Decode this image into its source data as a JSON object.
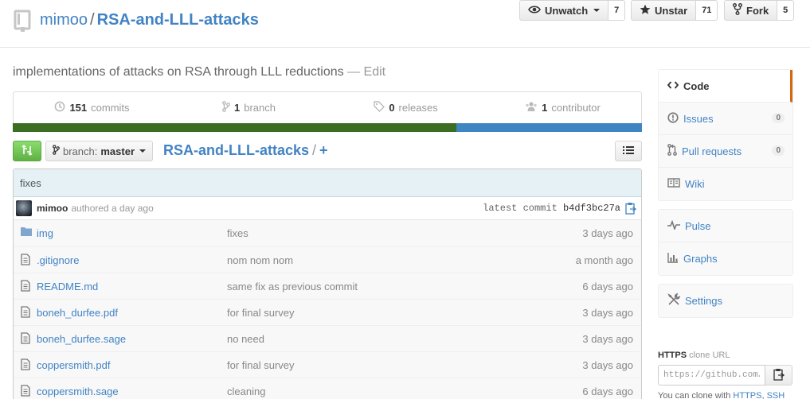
{
  "header": {
    "owner": "mimoo",
    "separator": "/",
    "repo_name": "RSA-and-LLL-attacks",
    "actions": [
      {
        "label": "Unwatch",
        "count": "7"
      },
      {
        "label": "Unstar",
        "count": "71"
      },
      {
        "label": "Fork",
        "count": "5"
      }
    ]
  },
  "description": {
    "text": "implementations of attacks on RSA through LLL reductions",
    "edit_sep": " — ",
    "edit_label": "Edit"
  },
  "summary": {
    "commits": {
      "count": "151",
      "label": "commits"
    },
    "branches": {
      "count": "1",
      "label": "branch"
    },
    "releases": {
      "count": "0",
      "label": "releases"
    },
    "contributors": {
      "count": "1",
      "label": "contributor"
    }
  },
  "language_bar": {
    "colors": [
      "#3b6e22",
      "#3e85c2"
    ],
    "fractions": [
      0.705,
      0.295
    ]
  },
  "file_nav": {
    "branch_label": "branch:",
    "branch_value": "master",
    "breadcrumb_root": "RSA-and-LLL-attacks",
    "breadcrumb_sep": "/",
    "breadcrumb_plus": "+"
  },
  "latest_commit": {
    "message": "fixes",
    "author": "mimoo",
    "ago": "authored a day ago",
    "latest_label": "latest commit",
    "sha": "b4df3bc27a"
  },
  "files": [
    {
      "icon": "folder-icon",
      "name": "img",
      "message": "fixes",
      "age": "3 days ago"
    },
    {
      "icon": "file-icon",
      "name": ".gitignore",
      "message": "nom nom nom",
      "age": "a month ago"
    },
    {
      "icon": "file-icon",
      "name": "README.md",
      "message": "same fix as previous commit",
      "age": "6 days ago"
    },
    {
      "icon": "file-icon",
      "name": "boneh_durfee.pdf",
      "message": "for final survey",
      "age": "3 days ago"
    },
    {
      "icon": "file-icon",
      "name": "boneh_durfee.sage",
      "message": "no need",
      "age": "3 days ago"
    },
    {
      "icon": "file-icon",
      "name": "coppersmith.pdf",
      "message": "for final survey",
      "age": "3 days ago"
    },
    {
      "icon": "file-icon",
      "name": "coppersmith.sage",
      "message": "cleaning",
      "age": "6 days ago"
    }
  ],
  "sidebar": {
    "items": [
      {
        "label": "Code",
        "icon": "code-icon",
        "selected": true
      },
      {
        "label": "Issues",
        "icon": "issue-icon",
        "badge": "0"
      },
      {
        "label": "Pull requests",
        "icon": "pull-request-icon",
        "badge": "0"
      },
      {
        "label": "Wiki",
        "icon": "book-icon"
      },
      {
        "label": "Pulse",
        "icon": "pulse-icon"
      },
      {
        "label": "Graphs",
        "icon": "graph-icon"
      },
      {
        "label": "Settings",
        "icon": "tools-icon"
      }
    ]
  },
  "clone": {
    "protocol": "HTTPS",
    "title_rest": "clone URL",
    "url": "https://github.com/mimoo/RSA-and-LLL-attacks.git",
    "help_prefix": "You can clone with",
    "help_https": "HTTPS",
    "help_sep": ",",
    "help_ssh": "SSH"
  }
}
